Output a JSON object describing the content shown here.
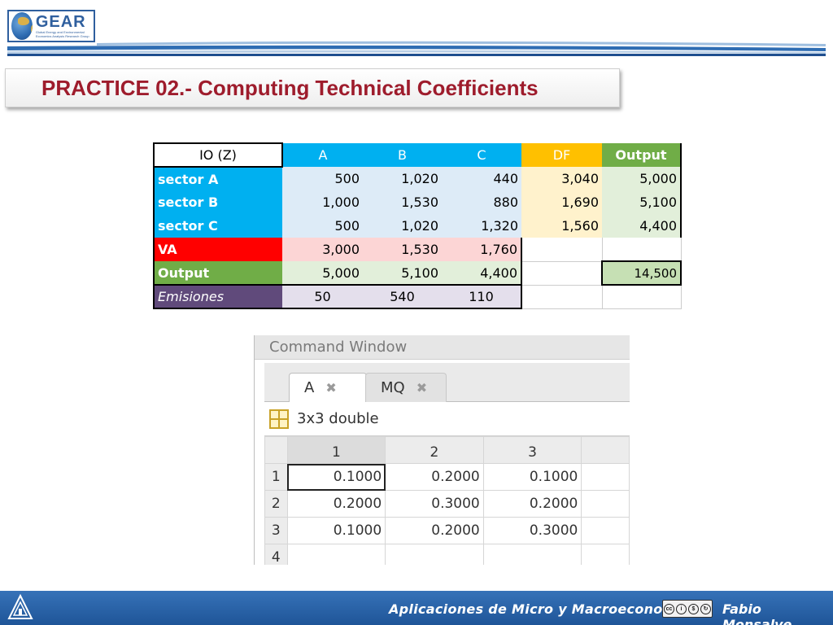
{
  "header": {
    "logo_name": "GEAR",
    "logo_sub": "Global Energy and Environmental Economics Analysis Research Group",
    "title": "PRACTICE 02.- Computing Technical Coefficients"
  },
  "io_table": {
    "corner": "IO (Z)",
    "columns": [
      "A",
      "B",
      "C",
      "DF",
      "Output"
    ],
    "rows": [
      {
        "label": "sector A",
        "values": [
          "500",
          "1,020",
          "440",
          "3,040",
          "5,000"
        ]
      },
      {
        "label": "sector B",
        "values": [
          "1,000",
          "1,530",
          "880",
          "1,690",
          "5,100"
        ]
      },
      {
        "label": "sector C",
        "values": [
          "500",
          "1,020",
          "1,320",
          "1,560",
          "4,400"
        ]
      },
      {
        "label": "VA",
        "values": [
          "3,000",
          "1,530",
          "1,760",
          "",
          ""
        ]
      },
      {
        "label": "Output",
        "values": [
          "5,000",
          "5,100",
          "4,400",
          "",
          "14,500"
        ]
      },
      {
        "label": "Emisiones",
        "values": [
          "50",
          "540",
          "110",
          "",
          ""
        ]
      }
    ],
    "colors": {
      "blue_header": "#00b0f0",
      "light_blue_cell": "#ddebf7",
      "yellow_header": "#ffc000",
      "light_yellow_cell": "#fff2cc",
      "green_header": "#70ad47",
      "light_green_cell": "#e2efda",
      "total_green_cell": "#c6e0b4",
      "red_header": "#ff0000",
      "light_red_cell": "#fcd5d5",
      "purple_header": "#604a7b",
      "light_purple_cell": "#e4dfec"
    }
  },
  "command_window": {
    "title": "Command Window",
    "tabs": [
      {
        "label": "A",
        "icon": "close-icon"
      },
      {
        "label": "MQ",
        "icon": "close-icon"
      }
    ],
    "variable_type": "3x3 double",
    "column_headers": [
      "1",
      "2",
      "3"
    ],
    "row_headers": [
      "1",
      "2",
      "3",
      "4"
    ],
    "cells": [
      [
        "0.1000",
        "0.2000",
        "0.1000"
      ],
      [
        "0.2000",
        "0.3000",
        "0.2000"
      ],
      [
        "0.1000",
        "0.2000",
        "0.3000"
      ],
      [
        "",
        "",
        ""
      ]
    ]
  },
  "footer": {
    "course": "Aplicaciones de Micro y Macroeconomía",
    "license": "cc by nc sa",
    "author": "Fabio Monsalve"
  }
}
